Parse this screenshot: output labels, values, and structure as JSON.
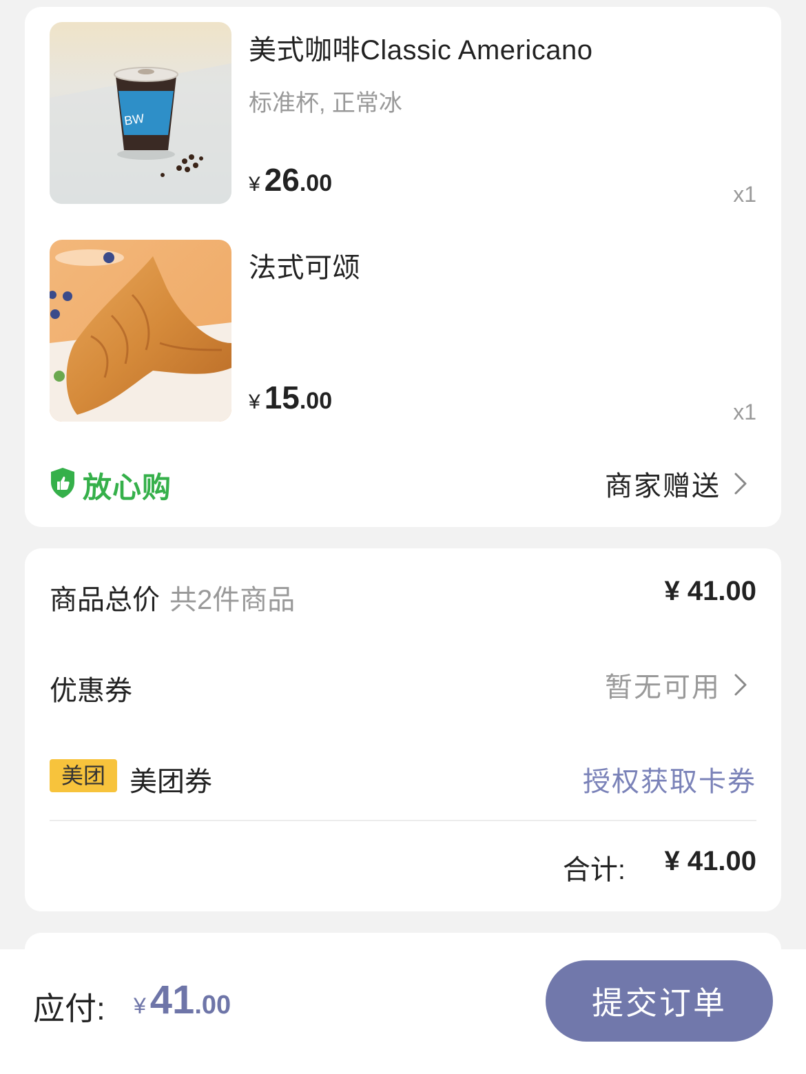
{
  "order_items": [
    {
      "name": "美式咖啡Classic Americano",
      "spec": "标准杯, 正常冰",
      "currency": "¥",
      "price_int": "26",
      "price_dec": ".00",
      "qty": "x1",
      "image": "americano-cup-image"
    },
    {
      "name": "法式可颂",
      "spec": "",
      "currency": "¥",
      "price_int": "15",
      "price_dec": ".00",
      "qty": "x1",
      "image": "croissant-image"
    }
  ],
  "assurance": {
    "label": "放心购",
    "icon": "shield-thumbs-up-icon",
    "color": "#35b04a"
  },
  "gift": {
    "label": "商家赠送",
    "icon": "chevron-right-icon"
  },
  "summary": {
    "total_label": "商品总价",
    "total_sub": "共2件商品",
    "total_amount": "¥ 41.00",
    "coupon_label": "优惠券",
    "coupon_status": "暂无可用",
    "meituan_badge": "美团",
    "meituan_label": "美团券",
    "meituan_action": "授权获取卡券",
    "sum_label": "合计:",
    "sum_amount": "¥ 41.00"
  },
  "footer": {
    "pay_label": "应付:",
    "currency": "¥",
    "amount_int": "41",
    "amount_dec": ".00",
    "submit_label": "提交订单"
  },
  "colors": {
    "accent": "#7178ab",
    "meituan_yellow": "#f7c33c",
    "link": "#7a82b8"
  }
}
